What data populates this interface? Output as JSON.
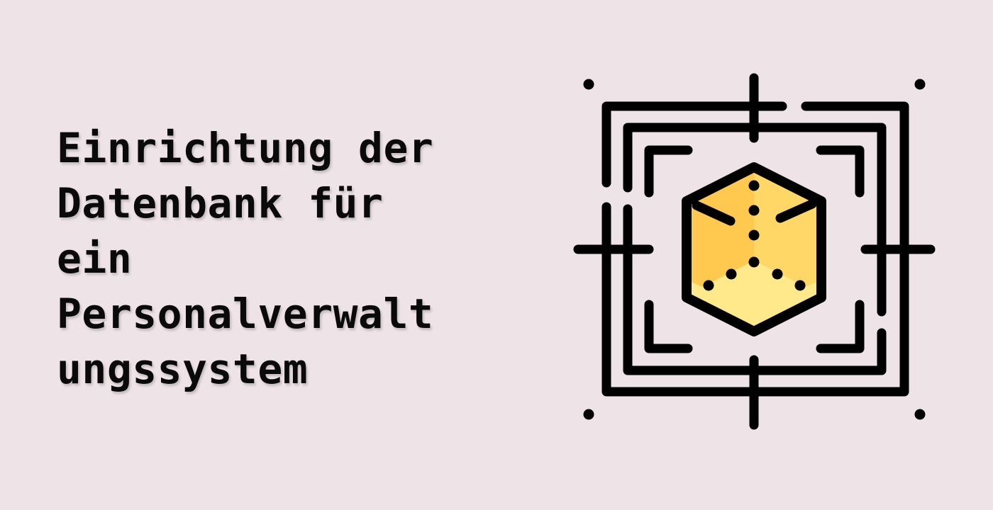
{
  "title_lines": [
    "Einrichtung der",
    "Datenbank für",
    "ein",
    "Personalverwalt",
    "ungssystem"
  ],
  "illustration": {
    "icon": "3d-cube-target-icon",
    "colors": {
      "background": "#EEE3E6",
      "stroke": "#000000",
      "cube_left": "#FFC84F",
      "cube_right": "#FFD766",
      "cube_bottom": "#FFE98A"
    }
  }
}
